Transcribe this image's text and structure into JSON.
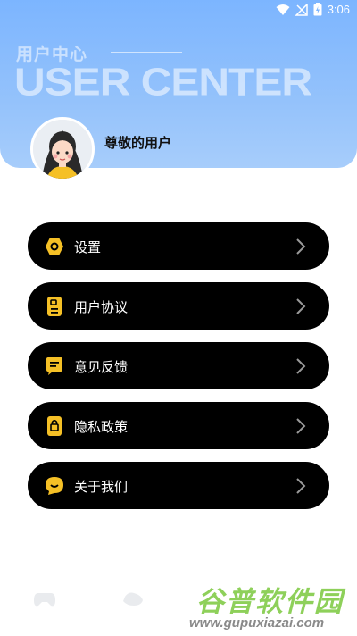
{
  "status_bar": {
    "time": "3:06",
    "icons": [
      "wifi-icon",
      "no-signal-icon",
      "battery-icon"
    ]
  },
  "header": {
    "title_cn": "用户中心",
    "title_en": "USER CENTER"
  },
  "profile": {
    "username": "尊敬的用户"
  },
  "menu": [
    {
      "label": "设置",
      "icon": "gear-icon"
    },
    {
      "label": "用户协议",
      "icon": "document-icon"
    },
    {
      "label": "意见反馈",
      "icon": "chat-icon"
    },
    {
      "label": "隐私政策",
      "icon": "privacy-icon"
    },
    {
      "label": "关于我们",
      "icon": "smile-icon"
    }
  ],
  "watermark": {
    "main": "谷普软件园",
    "url": "www.gupuxiazai.com"
  },
  "colors": {
    "accent": "#f5c026",
    "header": "#7cb5ff",
    "menu_bg": "#000000",
    "watermark": "#8ed05a"
  }
}
